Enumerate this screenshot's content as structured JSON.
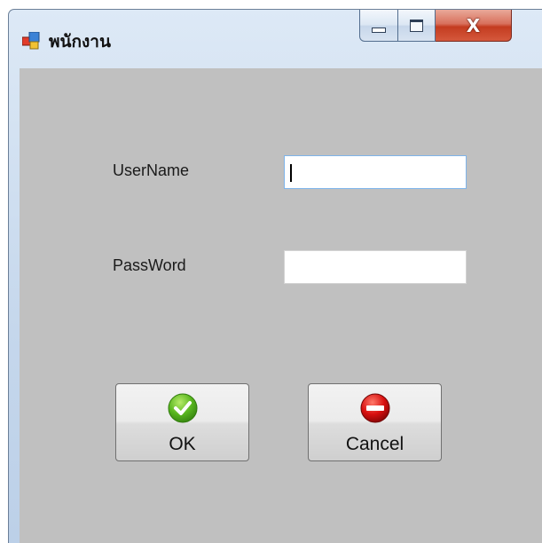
{
  "window": {
    "title": "พนักงาน",
    "controls": {
      "close_glyph": "X"
    }
  },
  "form": {
    "username_label": "UserName",
    "username_value": "",
    "password_label": "PassWord",
    "password_value": ""
  },
  "buttons": {
    "ok_label": "OK",
    "ok_icon": "green-check-icon",
    "cancel_label": "Cancel",
    "cancel_icon": "red-no-entry-icon"
  },
  "colors": {
    "client_background": "#c0c0c0",
    "ok_icon": "#58b51e",
    "cancel_icon": "#d80f0f"
  }
}
